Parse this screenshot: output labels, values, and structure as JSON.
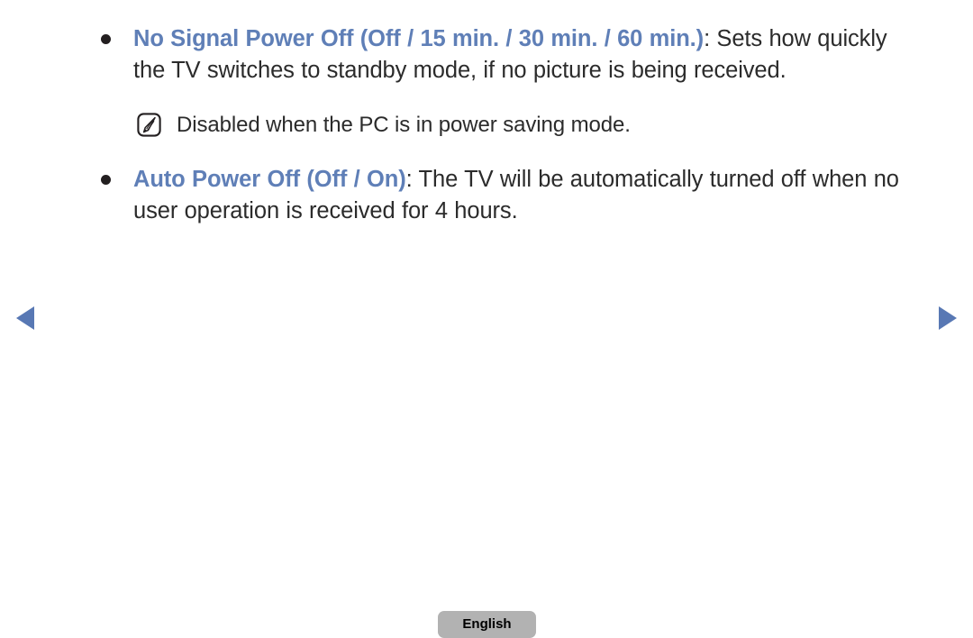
{
  "page": {
    "background_color": "#ffffff",
    "text_color": "#2b2b2b",
    "accent_color": "#5f7fb7",
    "bullet_color": "#231f20"
  },
  "content": {
    "bullets": [
      {
        "term": "No Signal Power Off (Off / 15 min. / 30 min. / 60 min.)",
        "description": ": Sets how quickly the TV switches to standby mode, if no picture is being received."
      },
      {
        "term": "Auto Power Off (Off / On)",
        "description": ": The TV will be automatically turned off when no user operation is received for 4 hours."
      }
    ],
    "note": {
      "icon": "note-pencil-icon",
      "text": "Disabled when the PC is in power saving mode."
    }
  },
  "navigation": {
    "prev": {
      "icon": "triangle-left-icon",
      "label": "Previous page",
      "color": "#5878b4"
    },
    "next": {
      "icon": "triangle-right-icon",
      "label": "Next page",
      "color": "#5878b4"
    }
  },
  "footer": {
    "language_button": {
      "label": "English",
      "background_color": "#b2b2b2"
    }
  }
}
